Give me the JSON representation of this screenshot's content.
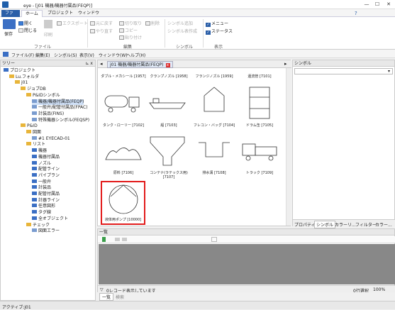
{
  "window": {
    "title": "eye - [j01 機器/機器付属品(FEQP)]",
    "controls": [
      "—",
      "☐",
      "✕"
    ],
    "help": "?"
  },
  "ribbon_tabs": [
    "ファイル",
    "ホーム",
    "プロジェクト",
    "ウィンドウ"
  ],
  "ribbon": {
    "file_group": {
      "label": "ファイル",
      "save": "保存",
      "open": "開く",
      "close": "閉じる",
      "print": "印刷",
      "export": "エクスポート"
    },
    "edit_group": {
      "label": "編集",
      "undo": "元に戻す",
      "redo": "やり直す",
      "cut": "切り取り",
      "copy": "コピー",
      "paste": "貼り付け",
      "delete": "削除"
    },
    "symbol_group": {
      "label": "シンボル",
      "add": "シンボル追加",
      "table": "シンボル表作成"
    },
    "view_group": {
      "label": "表示",
      "menu": "メニュー",
      "status": "ステータス"
    }
  },
  "menubar": [
    "ファイル(F)",
    "編集(E)",
    "シンボル(S)",
    "表示(V)",
    "ウィンドウ(W)",
    "ヘルプ(H)"
  ],
  "tree": {
    "header": "ツリー",
    "pin": "⊾ x",
    "nodes": [
      {
        "label": "プロジェクト",
        "level": 0,
        "icon": "blue"
      },
      {
        "label": "Lu.フォルダ",
        "level": 1,
        "icon": "folder"
      },
      {
        "label": "j01",
        "level": 2,
        "icon": "folder"
      },
      {
        "label": "ジョブDB",
        "level": 3,
        "icon": "folder"
      },
      {
        "label": "P&IDシンボル",
        "level": 4,
        "icon": "folder"
      },
      {
        "label": "機器/機器付属品(FEQP)",
        "level": 5,
        "icon": "doc"
      },
      {
        "label": "一般弁/配管付属品(FPAC)",
        "level": 5,
        "icon": "doc"
      },
      {
        "label": "計装品(FINS)",
        "level": 5,
        "icon": "doc"
      },
      {
        "label": "特殊機器シンボル(FEQSP)",
        "level": 5,
        "icon": "doc"
      },
      {
        "label": "P&ID",
        "level": 3,
        "icon": "folder"
      },
      {
        "label": "図面",
        "level": 4,
        "icon": "folder"
      },
      {
        "label": "#1 EYECAD-01",
        "level": 5,
        "icon": "doc"
      },
      {
        "label": "リスト",
        "level": 4,
        "icon": "folder"
      },
      {
        "label": "機器",
        "level": 5,
        "icon": "blue"
      },
      {
        "label": "機器付属品",
        "level": 5,
        "icon": "blue"
      },
      {
        "label": "ノズル",
        "level": 5,
        "icon": "blue"
      },
      {
        "label": "配管ライン",
        "level": 5,
        "icon": "blue"
      },
      {
        "label": "パイプラン",
        "level": 5,
        "icon": "blue"
      },
      {
        "label": "一般弁",
        "level": 5,
        "icon": "blue"
      },
      {
        "label": "計装品",
        "level": 5,
        "icon": "blue"
      },
      {
        "label": "配管付属品",
        "level": 5,
        "icon": "blue"
      },
      {
        "label": "計器ライン",
        "level": 5,
        "icon": "blue"
      },
      {
        "label": "任意図形",
        "level": 5,
        "icon": "blue"
      },
      {
        "label": "タグ線",
        "level": 5,
        "icon": "blue"
      },
      {
        "label": "全オブジェクト",
        "level": 5,
        "icon": "blue"
      },
      {
        "label": "チェック",
        "level": 4,
        "icon": "folder"
      },
      {
        "label": "図面エラー",
        "level": 5,
        "icon": "doc"
      }
    ]
  },
  "document": {
    "tab": "j01 機器/機器付属品(FEQP)",
    "top_labels": [
      "ダブル・メカシール [1957]",
      "クランプノズル [1958]",
      "フランジノズル [1959]",
      "還流管 [7101]"
    ],
    "row1": [
      "タンク・ローリー [7102]",
      "船 [7103]",
      "フレコン・バッグ [7104]",
      "ドラム缶 [7105]"
    ],
    "row2": [
      "原料 [7106]",
      "コンテナ(ラテックス用)\n[7107]",
      "排水溝 [7108]",
      "トラック [7109]"
    ],
    "row3": [
      "液体用ポンプ [10000]"
    ]
  },
  "symbol_panel": {
    "header": "シンボル",
    "tabs": [
      "プロパティ",
      "シンボル",
      "カラーリ...",
      "フィルター",
      "カラー..."
    ]
  },
  "list_panel": {
    "header": "一覧",
    "status": "0レコード表示しています",
    "zoom": "0行選択",
    "zoom_pct": "100%",
    "bottom_tabs": [
      "一覧",
      "検索"
    ]
  },
  "statusbar": {
    "text": "アクティブ:j01"
  }
}
